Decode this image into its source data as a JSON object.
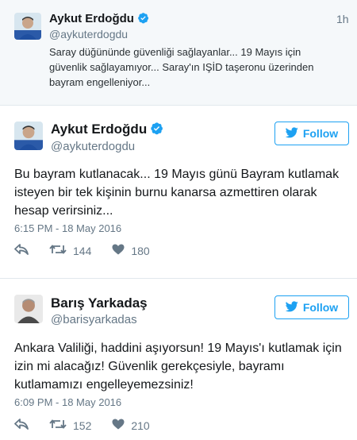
{
  "quoted_tweet": {
    "display_name": "Aykut Erdoğdu",
    "handle": "@aykuterdogdu",
    "time_ago": "1h",
    "text": "Saray düğününde güvenliği sağlayanlar... 19 Mayıs için güvenlik sağlayamıyor... Saray'ın IŞİD taşeronu üzerinden bayram engelleniyor..."
  },
  "tweets": [
    {
      "display_name": "Aykut Erdoğdu",
      "handle": "@aykuterdogdu",
      "verified": true,
      "follow_label": "Follow",
      "text": "Bu bayram kutlanacak... 19 Mayıs günü Bayram kutlamak isteyen bir tek kişinin burnu kanarsa azmettiren olarak hesap verirsiniz...",
      "timestamp": "6:15 PM - 18 May 2016",
      "retweets": "144",
      "likes": "180"
    },
    {
      "display_name": "Barış Yarkadaş",
      "handle": "@barisyarkadas",
      "verified": false,
      "follow_label": "Follow",
      "text": "Ankara Valiliği, haddini aşıyorsun! 19 Mayıs'ı kutlamak için izin mi alacağız! Güvenlik gerekçesiyle, bayramı kutlamamızı engelleyemezsiniz!",
      "timestamp": "6:09 PM - 18 May 2016",
      "retweets": "152",
      "likes": "210"
    }
  ],
  "colors": {
    "twitter_blue": "#1da1f2",
    "muted_text": "#657786",
    "verified_blue": "#1da1f2"
  },
  "icons": [
    "verified-icon",
    "reply-icon",
    "retweet-icon",
    "like-icon",
    "twitter-bird-icon"
  ]
}
